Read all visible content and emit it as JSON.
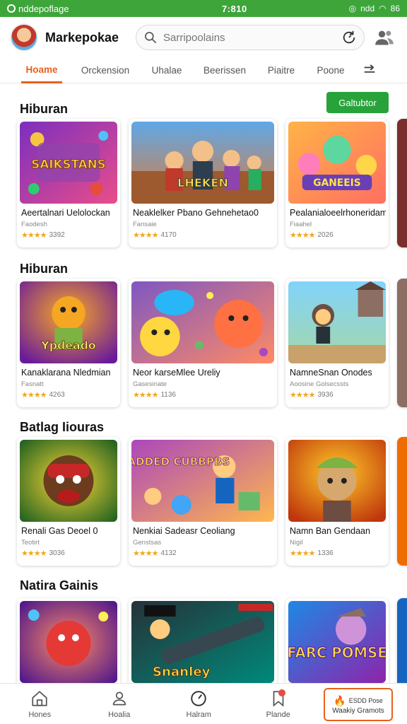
{
  "status_bar": {
    "left_text": "nddepoflage",
    "time": "7:810",
    "right_text": "ndd",
    "battery": "86"
  },
  "header": {
    "app_name": "Markepokae",
    "search_placeholder": "Sarripoolains"
  },
  "tabs": [
    "Hoame",
    "Orckension",
    "Uhalae",
    "Beerissen",
    "Piaitre",
    "Poone"
  ],
  "sections": [
    {
      "title": "Hiburan",
      "button_label": "Galtubtor",
      "cards": [
        {
          "title": "Aeertalnari Uelolockan",
          "sub": "Faodesh",
          "rating": "3392",
          "stars": "★★★★",
          "thumb_text": "SAIKSTANS"
        },
        {
          "title": "Neaklelker Pbano Gehnehetao0",
          "sub": "Fansaie",
          "rating": "4170",
          "stars": "★★★★",
          "thumb_text": "LHEKEN"
        },
        {
          "title": "Pealanialoeelrhoneridam",
          "sub": "Fiaahel",
          "rating": "2026",
          "stars": "★★★★",
          "thumb_text": "GANEEIS"
        }
      ]
    },
    {
      "title": "Hiburan",
      "button_label": "",
      "cards": [
        {
          "title": "Kanaklarana Nledmian",
          "sub": "Fasnatt",
          "rating": "4263",
          "stars": "★★★★",
          "thumb_text": "Ypdeado"
        },
        {
          "title": "Neor karseMlee Ureliy",
          "sub": "Gasesinate",
          "rating": "1136",
          "stars": "★★★★",
          "thumb_text": ""
        },
        {
          "title": "NamneSnan Onodes",
          "sub": "Aoosine Golsecssts",
          "rating": "3936",
          "stars": "★★★★",
          "thumb_text": ""
        }
      ]
    },
    {
      "title": "Batlag Iiouras",
      "button_label": "",
      "cards": [
        {
          "title": "Renali Gas Deoel 0",
          "sub": "Teotirt",
          "rating": "3036",
          "stars": "★★★★",
          "thumb_text": ""
        },
        {
          "title": "Nenkiai Sadeasr Ceoliang",
          "sub": "Genstsas",
          "rating": "4132",
          "stars": "★★★★",
          "thumb_text": "GADDED CUBBPBS"
        },
        {
          "title": "Namn Ban Gendaan",
          "sub": "Nigil",
          "rating": "1336",
          "stars": "★★★★",
          "thumb_text": ""
        }
      ]
    },
    {
      "title": "Natira Gainis",
      "button_label": "",
      "cards": [
        {
          "title": "",
          "sub": "",
          "rating": "",
          "stars": "",
          "thumb_text": ""
        },
        {
          "title": "",
          "sub": "",
          "rating": "",
          "stars": "",
          "thumb_text": "Snanley"
        },
        {
          "title": "",
          "sub": "",
          "rating": "",
          "stars": "",
          "thumb_text": "FARC POMSE"
        }
      ]
    }
  ],
  "bottom_nav": {
    "items": [
      "Hones",
      "Hoalia",
      "Halram",
      "Plande"
    ],
    "promo_line1": "ESDD Pose",
    "promo_line2": "Waakiy Gramots"
  },
  "colors": {
    "brand_green": "#3ea53a",
    "accent_orange": "#e8611a",
    "button_green": "#27a33a",
    "star": "#f0a71b"
  }
}
